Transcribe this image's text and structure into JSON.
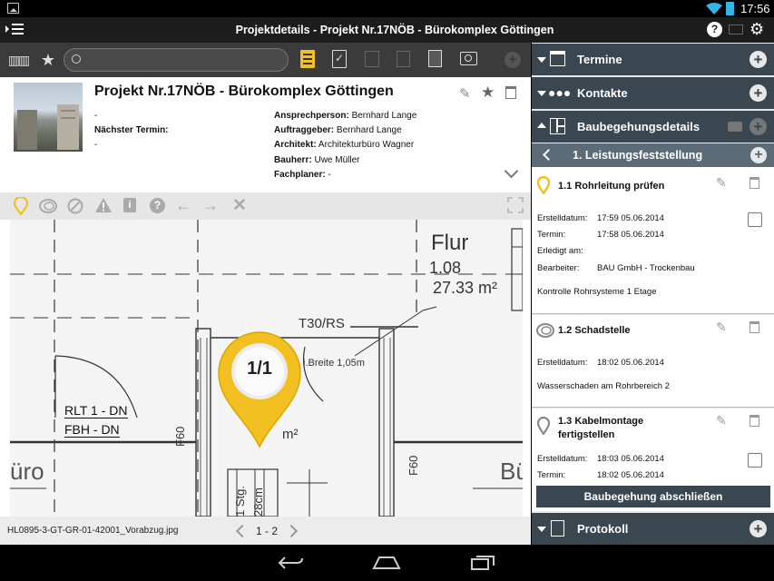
{
  "status_bar": {
    "time": "17:56"
  },
  "title_bar": {
    "title": "Projektdetails - Projekt Nr.17NÖB - Bürokomplex Göttingen"
  },
  "project": {
    "title": "Projekt Nr.17NÖB - Bürokomplex Göttingen",
    "dash1": "-",
    "next_date_label": "Nächster Termin:",
    "dash2": "-",
    "fields": [
      {
        "label": "Ansprechperson:",
        "value": "Bernhard Lange"
      },
      {
        "label": "Auftraggeber:",
        "value": "Bernhard Lange"
      },
      {
        "label": "Architekt:",
        "value": "Architekturbüro Wagner"
      },
      {
        "label": "Bauherr:",
        "value": "Uwe Müller"
      },
      {
        "label": "Fachplaner:",
        "value": "-"
      }
    ]
  },
  "plan": {
    "marker_label": "1/1",
    "filename": "HL0895-3-GT-GR-01-42001_Vorabzug.jpg",
    "page": "1 - 2",
    "texts": {
      "flur": "Flur",
      "area1": "1.08",
      "area2": "27.33 m²",
      "t30": "T30/RS",
      "breite": "i.Breite 1,05m",
      "rlt": "RLT 1 - DN",
      "fbh": "FBH - DN",
      "m2": "m²",
      "f60a": "F60",
      "f60b": "F60",
      "uro": "üro",
      "bu": "Bü",
      "stg": "1 Stg.",
      "dim": "28cm"
    }
  },
  "sidebar": {
    "sections": {
      "termine": "Termine",
      "kontakte": "Kontakte",
      "baubegehung": "Baubegehungsdetails",
      "leistung": "1. Leistungsfeststellung",
      "protokoll": "Protokoll"
    },
    "items": [
      {
        "title": "1.1 Rohrleitung prüfen",
        "rows": [
          {
            "label": "Erstelldatum:",
            "value": "17:59 05.06.2014"
          },
          {
            "label": "Termin:",
            "value": "17:58 05.06.2014"
          },
          {
            "label": "Erledigt am:",
            "value": ""
          },
          {
            "label": "Bearbeiter:",
            "value": "BAU GmbH - Trockenbau"
          }
        ],
        "note": "Kontrolle Rohrsysteme 1 Etage"
      },
      {
        "title": "1.2 Schadstelle",
        "rows": [
          {
            "label": "Erstelldatum:",
            "value": "18:02 05.06.2014"
          }
        ],
        "note": "Wasserschaden am Rohrbereich 2"
      },
      {
        "title_line1": "1.3 Kabelmontage",
        "title_line2": "fertigstellen",
        "rows": [
          {
            "label": "Erstelldatum:",
            "value": "18:03 05.06.2014"
          },
          {
            "label": "Termin:",
            "value": "18:02 05.06.2014"
          }
        ]
      }
    ],
    "finish_button": "Baubegehung abschließen"
  },
  "colors": {
    "accent_yellow": "#f2c021",
    "sidebar_header": "#3a4650",
    "sub_header": "#5b6c78"
  }
}
